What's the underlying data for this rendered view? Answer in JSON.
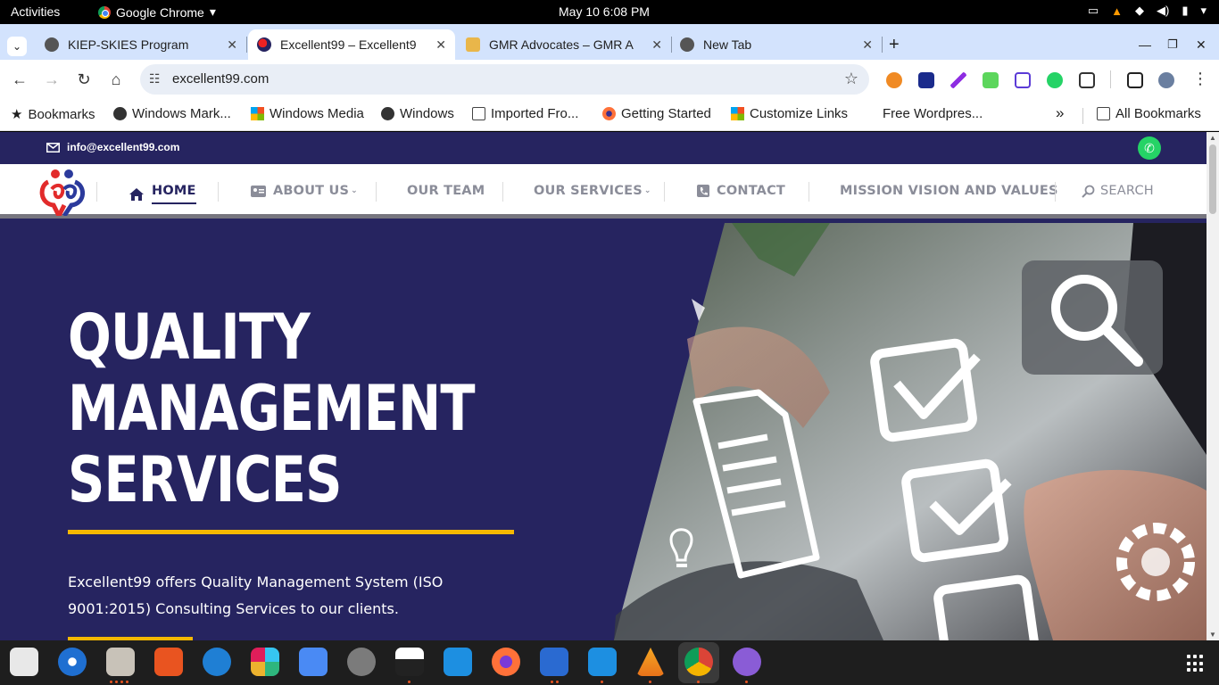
{
  "topbar": {
    "activities": "Activities",
    "app_name": "Google Chrome",
    "clock": "May 10   6:08 PM"
  },
  "tabs": [
    {
      "title": "KIEP-SKIES Program",
      "active": false
    },
    {
      "title": "Excellent99 – Excellent9",
      "active": true
    },
    {
      "title": "GMR Advocates – GMR A",
      "active": false
    },
    {
      "title": "New Tab",
      "active": false
    }
  ],
  "toolbar": {
    "url": "excellent99.com"
  },
  "bookmarks": {
    "items": [
      "Bookmarks",
      "Windows Mark...",
      "Windows Media",
      "Windows",
      "Imported Fro...",
      "Getting Started",
      "Customize Links",
      "Free Wordpres..."
    ],
    "overflow": "»",
    "all": "All Bookmarks"
  },
  "site": {
    "email": "info@excellent99.com",
    "nav": {
      "home": "HOME",
      "about": "ABOUT US",
      "team": "OUR TEAM",
      "services": "OUR SERVICES",
      "contact": "CONTACT",
      "mission": "MISSION VISION AND VALUES",
      "search": "SEARCH"
    },
    "hero": {
      "line1": "QUALITY",
      "line2": "MANAGEMENT",
      "line3": "SERVICES",
      "text": "Excellent99 offers Quality Management System (ISO 9001:2015) Consulting Services to our clients."
    },
    "colors": {
      "navy": "#262460",
      "accent": "#f6b800"
    }
  },
  "dock": {
    "apps": [
      "text-editor-icon",
      "thunderbird-icon",
      "files-icon",
      "app-center-icon",
      "help-icon",
      "slack-icon",
      "google-docs-icon",
      "settings-icon",
      "inkscape-icon",
      "vscode-icon",
      "firefox-icon",
      "document-viewer-icon",
      "vscode-alt-icon",
      "vlc-icon",
      "chrome-icon",
      "network-icon"
    ]
  }
}
